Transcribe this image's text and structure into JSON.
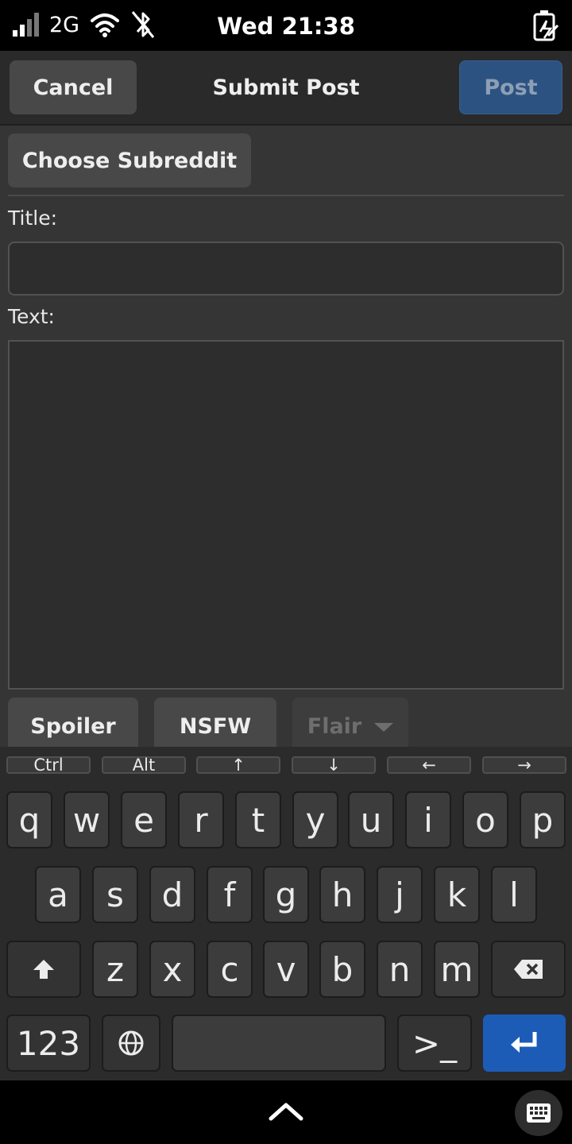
{
  "status_bar": {
    "network": "2G",
    "time": "Wed 21:38",
    "icons": [
      "signal-icon",
      "wifi-icon",
      "bluetooth-disabled-icon",
      "battery-charging-icon"
    ]
  },
  "header": {
    "cancel_label": "Cancel",
    "title": "Submit Post",
    "post_label": "Post"
  },
  "form": {
    "subreddit_button": "Choose Subreddit",
    "title_label": "Title:",
    "title_value": "",
    "text_label": "Text:",
    "text_value": "",
    "toggles": {
      "spoiler": "Spoiler",
      "nsfw": "NSFW",
      "flair": "Flair"
    }
  },
  "keyboard": {
    "modifiers": [
      "Ctrl",
      "Alt",
      "↑",
      "↓",
      "←",
      "→"
    ],
    "row1": [
      "q",
      "w",
      "e",
      "r",
      "t",
      "y",
      "u",
      "i",
      "o",
      "p"
    ],
    "row2": [
      "a",
      "s",
      "d",
      "f",
      "g",
      "h",
      "j",
      "k",
      "l"
    ],
    "row3": [
      "z",
      "x",
      "c",
      "v",
      "b",
      "n",
      "m"
    ],
    "numbers_label": "123",
    "terminal_label": ">_",
    "accent_color": "#1c5cb7"
  },
  "colors": {
    "post_button": "#2b5281",
    "app_background": "#353535"
  }
}
